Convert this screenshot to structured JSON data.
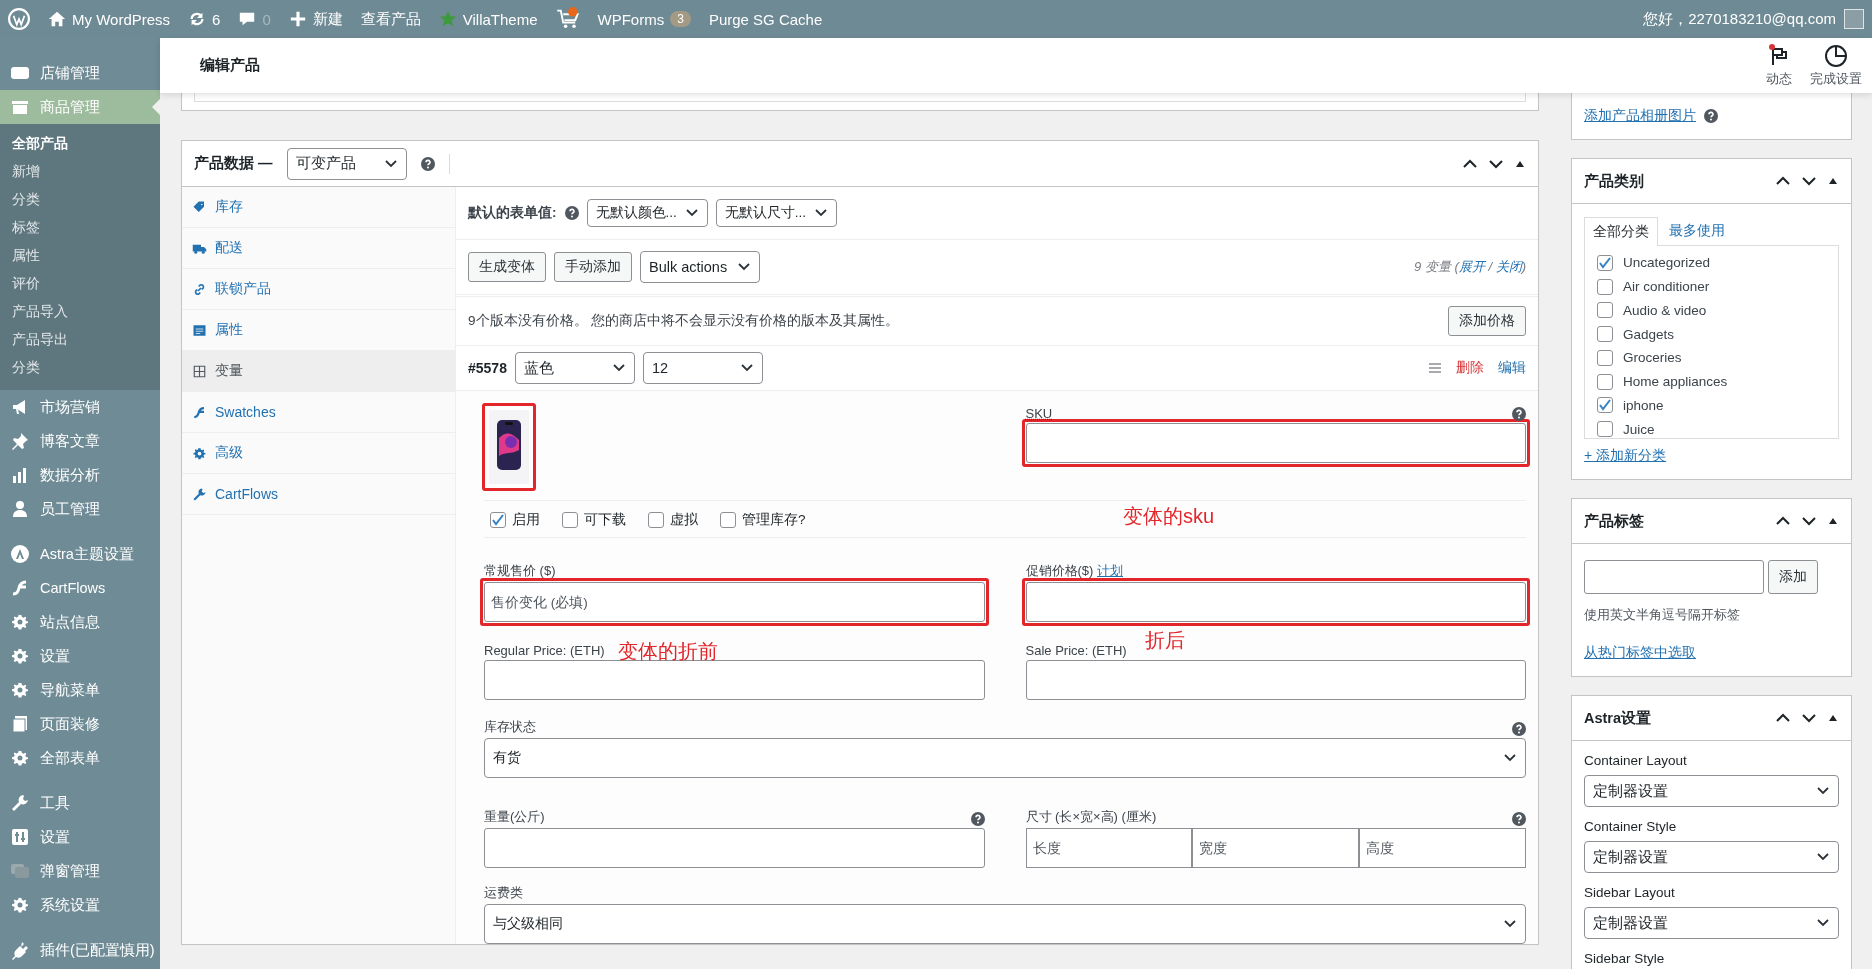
{
  "admin_bar": {
    "site": "My WordPress",
    "updates": "6",
    "comments": "0",
    "new": "新建",
    "view": "查看产品",
    "villatheme": "VillaTheme",
    "wpforms": "WPForms",
    "wpforms_count": "3",
    "purge": "Purge SG Cache",
    "greeting": "您好，2270183210@qq.com"
  },
  "sidebar": {
    "groups": [
      [
        {
          "label": "店铺管理",
          "selected": false
        },
        {
          "label": "商品管理",
          "selected": true,
          "children": [
            {
              "label": "全部产品",
              "selected": true
            },
            {
              "label": "新增",
              "selected": false
            },
            {
              "label": "分类",
              "selected": false
            },
            {
              "label": "标签",
              "selected": false
            },
            {
              "label": "属性",
              "selected": false
            },
            {
              "label": "评价",
              "selected": false
            },
            {
              "label": "产品导入",
              "selected": false
            },
            {
              "label": "产品导出",
              "selected": false
            },
            {
              "label": "分类",
              "selected": false
            }
          ]
        },
        {
          "label": "市场营销",
          "selected": false
        },
        {
          "label": "博客文章",
          "selected": false
        },
        {
          "label": "数据分析",
          "selected": false
        },
        {
          "label": "员工管理",
          "selected": false
        }
      ],
      [
        {
          "label": "Astra主题设置",
          "selected": false
        },
        {
          "label": "CartFlows",
          "selected": false
        },
        {
          "label": "站点信息",
          "selected": false
        },
        {
          "label": "设置",
          "selected": false
        },
        {
          "label": "导航菜单",
          "selected": false
        },
        {
          "label": "页面装修",
          "selected": false
        },
        {
          "label": "全部表单",
          "selected": false
        }
      ],
      [
        {
          "label": "工具",
          "selected": false
        },
        {
          "label": "设置",
          "selected": false
        },
        {
          "label": "弹窗管理",
          "selected": false
        },
        {
          "label": "系统设置",
          "selected": false
        }
      ],
      [
        {
          "label": "插件(已配置慎用)",
          "selected": false
        }
      ]
    ]
  },
  "header": {
    "title": "编辑产品",
    "actions": [
      {
        "label": "动态",
        "notification": true
      },
      {
        "label": "完成设置",
        "notification": false
      }
    ]
  },
  "product_data": {
    "title": "产品数据 —",
    "type": "可变产品",
    "tabs": [
      {
        "label": "库存",
        "selected": false
      },
      {
        "label": "配送",
        "selected": false
      },
      {
        "label": "联锁产品",
        "selected": false
      },
      {
        "label": "属性",
        "selected": false
      },
      {
        "label": "变量",
        "selected": true
      },
      {
        "label": "Swatches",
        "selected": false
      },
      {
        "label": "高级",
        "selected": false
      },
      {
        "label": "CartFlows",
        "selected": false
      }
    ],
    "default_form_label": "默认的表单值:",
    "defaults": [
      "无默认颜色...",
      "无默认尺寸..."
    ],
    "buttons": [
      "生成变体",
      "手动添加"
    ],
    "bulk_actions": "Bulk actions",
    "count_open": "9 变量 (",
    "expand": "展开",
    "count_separator": " / ",
    "collapse": "关闭",
    "count_close": ")",
    "notice": "9个版本没有价格。 您的商店中将不会显示没有价格的版本及其属性。",
    "add_price": "添加价格",
    "variation": {
      "id": "#5578",
      "attributes": [
        "蓝色",
        "12"
      ],
      "remove": "删除",
      "edit": "编辑",
      "image": {
        "kind": "picture",
        "highlighted": true
      },
      "sku": {
        "label": "SKU",
        "highlighted": true
      },
      "options": [
        {
          "label": "启用",
          "checked": true
        },
        {
          "label": "可下载",
          "checked": false
        },
        {
          "label": "虚拟",
          "checked": false
        },
        {
          "label": "管理库存?",
          "checked": false
        }
      ],
      "price_fields": [
        {
          "label": "常规售价 ($)",
          "placeholder": "售价变化 (必填)",
          "highlighted": true
        },
        {
          "label": "促销价格($)",
          "link": "计划",
          "highlighted": true
        },
        {
          "label": "Regular Price: (ETH)",
          "highlighted": false
        },
        {
          "label": "Sale Price: (ETH)",
          "highlighted": false
        }
      ],
      "stock_status": {
        "label": "库存状态",
        "value": "有货"
      },
      "weight": {
        "label": "重量(公斤)"
      },
      "dimensions": {
        "label": "尺寸 (长×宽×高) (厘米)",
        "placeholders": [
          "长度",
          "宽度",
          "高度"
        ]
      },
      "shipping_class": {
        "label": "运费类",
        "value": "与父级相同"
      }
    },
    "annotations": [
      {
        "text": "变体的sku"
      },
      {
        "text": "变体的折前"
      },
      {
        "text": "折后"
      }
    ]
  },
  "right": {
    "gallery_link": "添加产品相册图片",
    "categories": {
      "title": "产品类别",
      "tabs": [
        {
          "label": "全部分类",
          "selected": true
        },
        {
          "label": "最多使用",
          "selected": false
        }
      ],
      "items": [
        {
          "label": "Uncategorized",
          "checked": true
        },
        {
          "label": "Air conditioner",
          "checked": false
        },
        {
          "label": "Audio & video",
          "checked": false
        },
        {
          "label": "Gadgets",
          "checked": false
        },
        {
          "label": "Groceries",
          "checked": false
        },
        {
          "label": "Home appliances",
          "checked": false
        },
        {
          "label": "iphone",
          "checked": true
        },
        {
          "label": "Juice",
          "checked": false
        }
      ],
      "add_link": "+ 添加新分类"
    },
    "tags": {
      "title": "产品标签",
      "button": "添加",
      "hint": "使用英文半角逗号隔开标签",
      "link": "从热门标签中选取"
    },
    "astra": {
      "title": "Astra设置",
      "settings": [
        {
          "label": "Container Layout",
          "value": "定制器设置"
        },
        {
          "label": "Container Style",
          "value": "定制器设置"
        },
        {
          "label": "Sidebar Layout",
          "value": "定制器设置"
        },
        {
          "label": "Sidebar Style"
        }
      ]
    }
  }
}
